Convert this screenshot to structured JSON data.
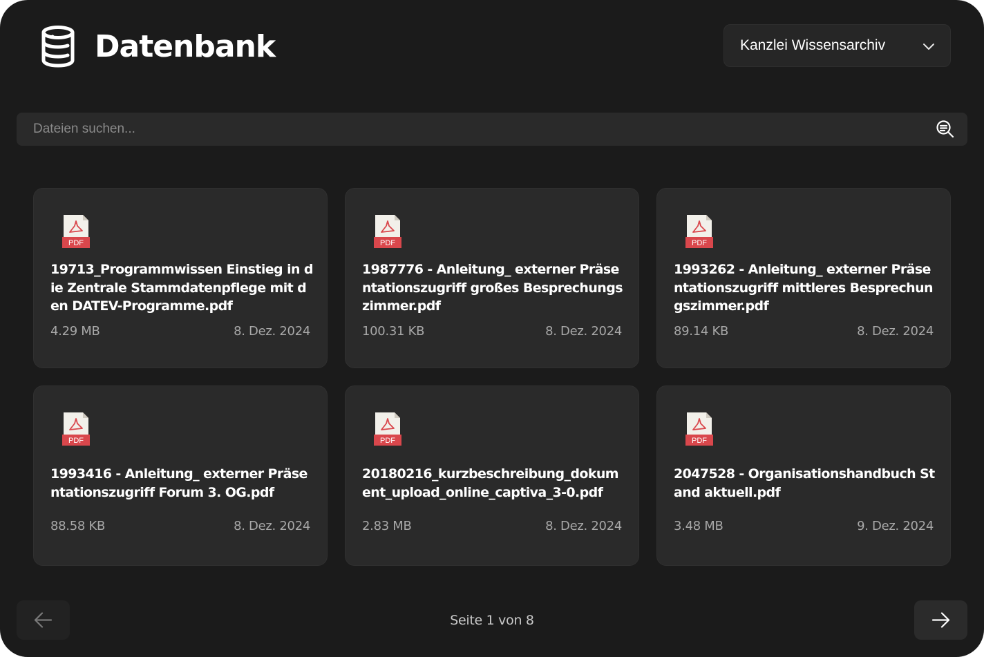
{
  "header": {
    "title": "Datenbank",
    "archive_select": {
      "selected": "Kanzlei Wissensarchiv",
      "icon": "chevron-down-icon"
    }
  },
  "search": {
    "placeholder": "Dateien suchen...",
    "value": "",
    "icon": "search-icon"
  },
  "files": [
    {
      "type": "PDF",
      "name": "19713_Programmwissen Einstieg in die Zentrale Stammdatenpflege mit den DATEV-Programme.pdf",
      "size": "4.29 MB",
      "date": "8. Dez. 2024"
    },
    {
      "type": "PDF",
      "name": "1987776 - Anleitung_ externer Präsentationszugriff großes Besprechungszimmer.pdf",
      "size": "100.31 KB",
      "date": "8. Dez. 2024"
    },
    {
      "type": "PDF",
      "name": "1993262 - Anleitung_ externer Präsentationszugriff mittleres Besprechungszimmer.pdf",
      "size": "89.14 KB",
      "date": "8. Dez. 2024"
    },
    {
      "type": "PDF",
      "name": "1993416 - Anleitung_ externer Präsentationszugriff Forum 3. OG.pdf",
      "size": "88.58 KB",
      "date": "8. Dez. 2024"
    },
    {
      "type": "PDF",
      "name": "20180216_kurzbeschreibung_dokument_upload_online_captiva_3-0.pdf",
      "size": "2.83 MB",
      "date": "8. Dez. 2024"
    },
    {
      "type": "PDF",
      "name": "2047528 - Organisationshandbuch Stand aktuell.pdf",
      "size": "3.48 MB",
      "date": "9. Dez. 2024"
    }
  ],
  "pagination": {
    "label": "Seite 1 von 8",
    "current_page": 1,
    "total_pages": 8,
    "prev_icon": "arrow-left-icon",
    "next_icon": "arrow-right-icon"
  },
  "colors": {
    "background": "#1b1b1b",
    "card": "#2a2a2a",
    "pdf_red": "#d9474c",
    "pdf_paper": "#f2f0ea"
  }
}
